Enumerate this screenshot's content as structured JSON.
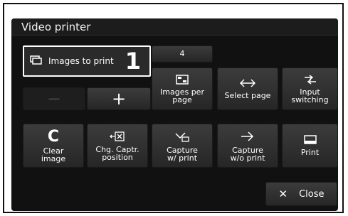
{
  "window": {
    "title": "Video printer"
  },
  "images_to_print": {
    "label": "Images to print",
    "callout": "1"
  },
  "images_per_page": {
    "count": "4",
    "label": "Images per\npage"
  },
  "stepper": {
    "minus": "−",
    "plus": "+"
  },
  "buttons": {
    "select_page": "Select page",
    "input_switching": "Input\nswitching",
    "clear_image": "Clear\nimage",
    "clear_glyph": "C",
    "chg_capture": "Chg. Captr.\nposition",
    "capture_print": "Capture\nw/ print",
    "capture_no_print": "Capture\nw/o print",
    "print": "Print",
    "close": "Close",
    "close_glyph": "✕"
  },
  "icons": [
    "layers-icon",
    "grid-icon",
    "double-arrow-icon",
    "input-switch-icon",
    "capture-position-icon",
    "capture-print-icon",
    "capture-arrow-icon",
    "print-icon"
  ]
}
